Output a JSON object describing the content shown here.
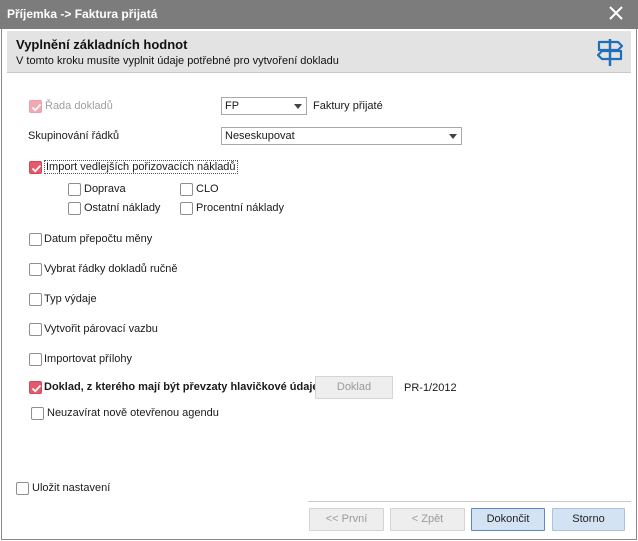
{
  "window": {
    "title": "Příjemka -> Faktura přijatá",
    "close_icon": "close-icon"
  },
  "header": {
    "title": "Vyplnění základních hodnot",
    "subtitle": "V tomto kroku musíte vyplnit údaje potřebné pro vytvoření dokladu",
    "icon": "signpost-icon"
  },
  "form": {
    "rada": {
      "label": "Řada dokladů",
      "checked": true,
      "disabled": true,
      "value": "FP",
      "description": "Faktury přijaté"
    },
    "skupinovani": {
      "label": "Skupinování řádků",
      "value": "Neseskupovat"
    },
    "import_naklady": {
      "label": "Import vedlejších pořizovacích nákladů",
      "checked": true,
      "sub": [
        {
          "label": "Doprava",
          "checked": false
        },
        {
          "label": "CLO",
          "checked": false
        },
        {
          "label": "Ostatní náklady",
          "checked": false
        },
        {
          "label": "Procentní náklady",
          "checked": false
        }
      ]
    },
    "datum_prepoctu": {
      "label": "Datum přepočtu měny",
      "checked": false
    },
    "vybrat_radky": {
      "label": "Vybrat řádky dokladů ručně",
      "checked": false
    },
    "typ_vydaje": {
      "label": "Typ výdaje",
      "checked": false
    },
    "parovaci_vazba": {
      "label": "Vytvořit párovací vazbu",
      "checked": false
    },
    "importovat_prilohy": {
      "label": "Importovat přílohy",
      "checked": false
    },
    "doklad_hlavicka": {
      "label": "Doklad, z kterého mají být převzaty hlavičkové údaje",
      "checked": true,
      "button_label": "Doklad",
      "value": "PR-1/2012"
    },
    "neuzavirat": {
      "label": "Neuzavírat nově otevřenou agendu",
      "checked": false
    }
  },
  "footer": {
    "ulozit": {
      "label": "Uložit nastavení",
      "checked": false
    },
    "buttons": {
      "prvni": "<< První",
      "zpet": "< Zpět",
      "dokoncit": "Dokončit",
      "storno": "Storno"
    }
  },
  "colors": {
    "titlebar": "#7c7c7c",
    "header_bg": "#e3e3e3",
    "check_accent": "#e25a6c",
    "primary_button": "#d3e3f3"
  }
}
